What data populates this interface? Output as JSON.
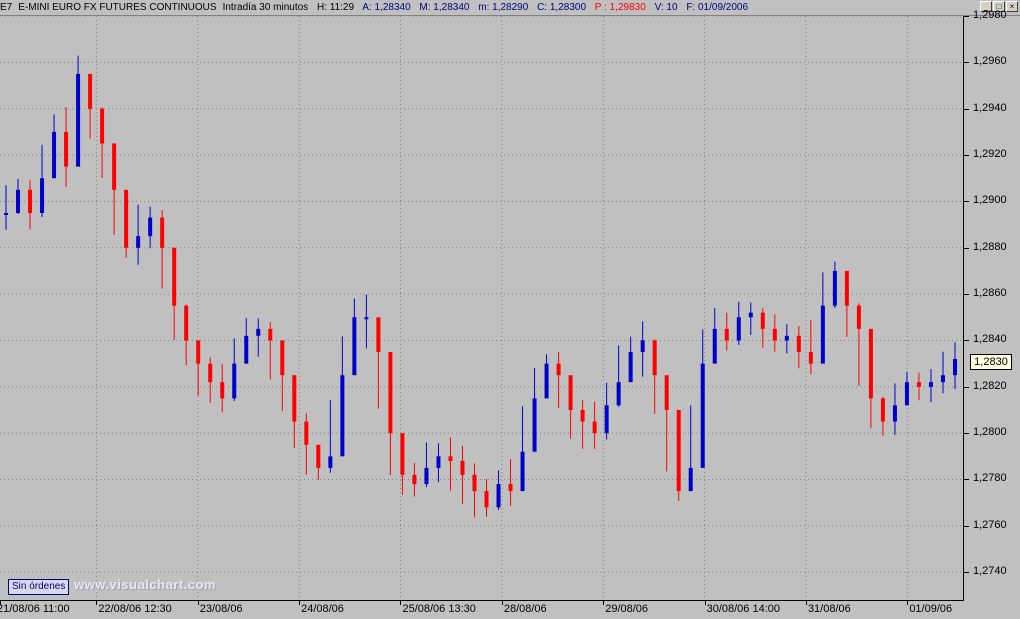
{
  "header": {
    "symbol": "E7",
    "name": "E-MINI EURO FX FUTURES CONTINUOUS",
    "period": "Intradía 30 minutos",
    "hour": "H: 11:29",
    "open": "A: 1,28340",
    "max": "M: 1,28340",
    "min": "m: 1,28290",
    "close": "C: 1,28300",
    "pointer": "P : 1,29830",
    "volume": "V: 10",
    "date": "F: 01/09/2006"
  },
  "window_buttons": [
    "_",
    "□",
    "×"
  ],
  "orders_label": "Sin órdenes",
  "watermark": "www.visualchart.com",
  "last_price_label": "1,2830",
  "colors": {
    "up": "#0000cc",
    "down": "#ff0000",
    "background": "#c0c0c0",
    "grid": "#808080"
  },
  "chart_data": {
    "type": "candlestick",
    "grid": true,
    "ylim": [
      1.2728,
      1.298
    ],
    "yticks": [
      "1,2740",
      "1,2760",
      "1,2780",
      "1,2800",
      "1,2820",
      "1,2840",
      "1,2860",
      "1,2880",
      "1,2900",
      "1,2920",
      "1,2940",
      "1,2960",
      "1,2980"
    ],
    "yticks_values": [
      1.274,
      1.276,
      1.278,
      1.28,
      1.282,
      1.284,
      1.286,
      1.288,
      1.29,
      1.292,
      1.294,
      1.296,
      1.298
    ],
    "xticks": [
      "21/08/06 11:00",
      "22/08/06 12:30",
      "23/08/06",
      "24/08/06",
      "25/08/06 13:30",
      "28/08/06",
      "29/08/06",
      "30/08/06 14:00",
      "31/08/06",
      "01/09/06"
    ],
    "series": [
      {
        "values": [
          1.2895,
          1.2905,
          1.2895,
          1.291,
          1.293,
          1.2915,
          1.2955,
          1.294,
          1.2925,
          1.2905,
          1.288,
          1.2885,
          1.2893,
          1.288,
          1.2855,
          1.284,
          1.283,
          1.2822,
          1.2815,
          1.283,
          1.2842,
          1.2845,
          1.284,
          1.2825,
          1.2805,
          1.2795,
          1.2785,
          1.279,
          1.2825,
          1.285,
          1.285,
          1.2835,
          1.28,
          1.2782,
          1.2778,
          1.2785,
          1.279,
          1.2788,
          1.2782,
          1.2775,
          1.2768,
          1.2778,
          1.2775,
          1.2792,
          1.2815,
          1.283,
          1.2825,
          1.281,
          1.2805,
          1.28,
          1.2812,
          1.2822,
          1.2835,
          1.284,
          1.2825,
          1.281,
          1.2775,
          1.2785,
          1.283,
          1.2845,
          1.284,
          1.285,
          1.2852,
          1.2845,
          1.284,
          1.2842,
          1.2835,
          1.283,
          1.2855,
          1.287,
          1.2855,
          1.2845,
          1.2815,
          1.2805,
          1.2812,
          1.2822,
          1.282,
          1.2822,
          1.2825,
          1.2832
        ]
      }
    ]
  }
}
